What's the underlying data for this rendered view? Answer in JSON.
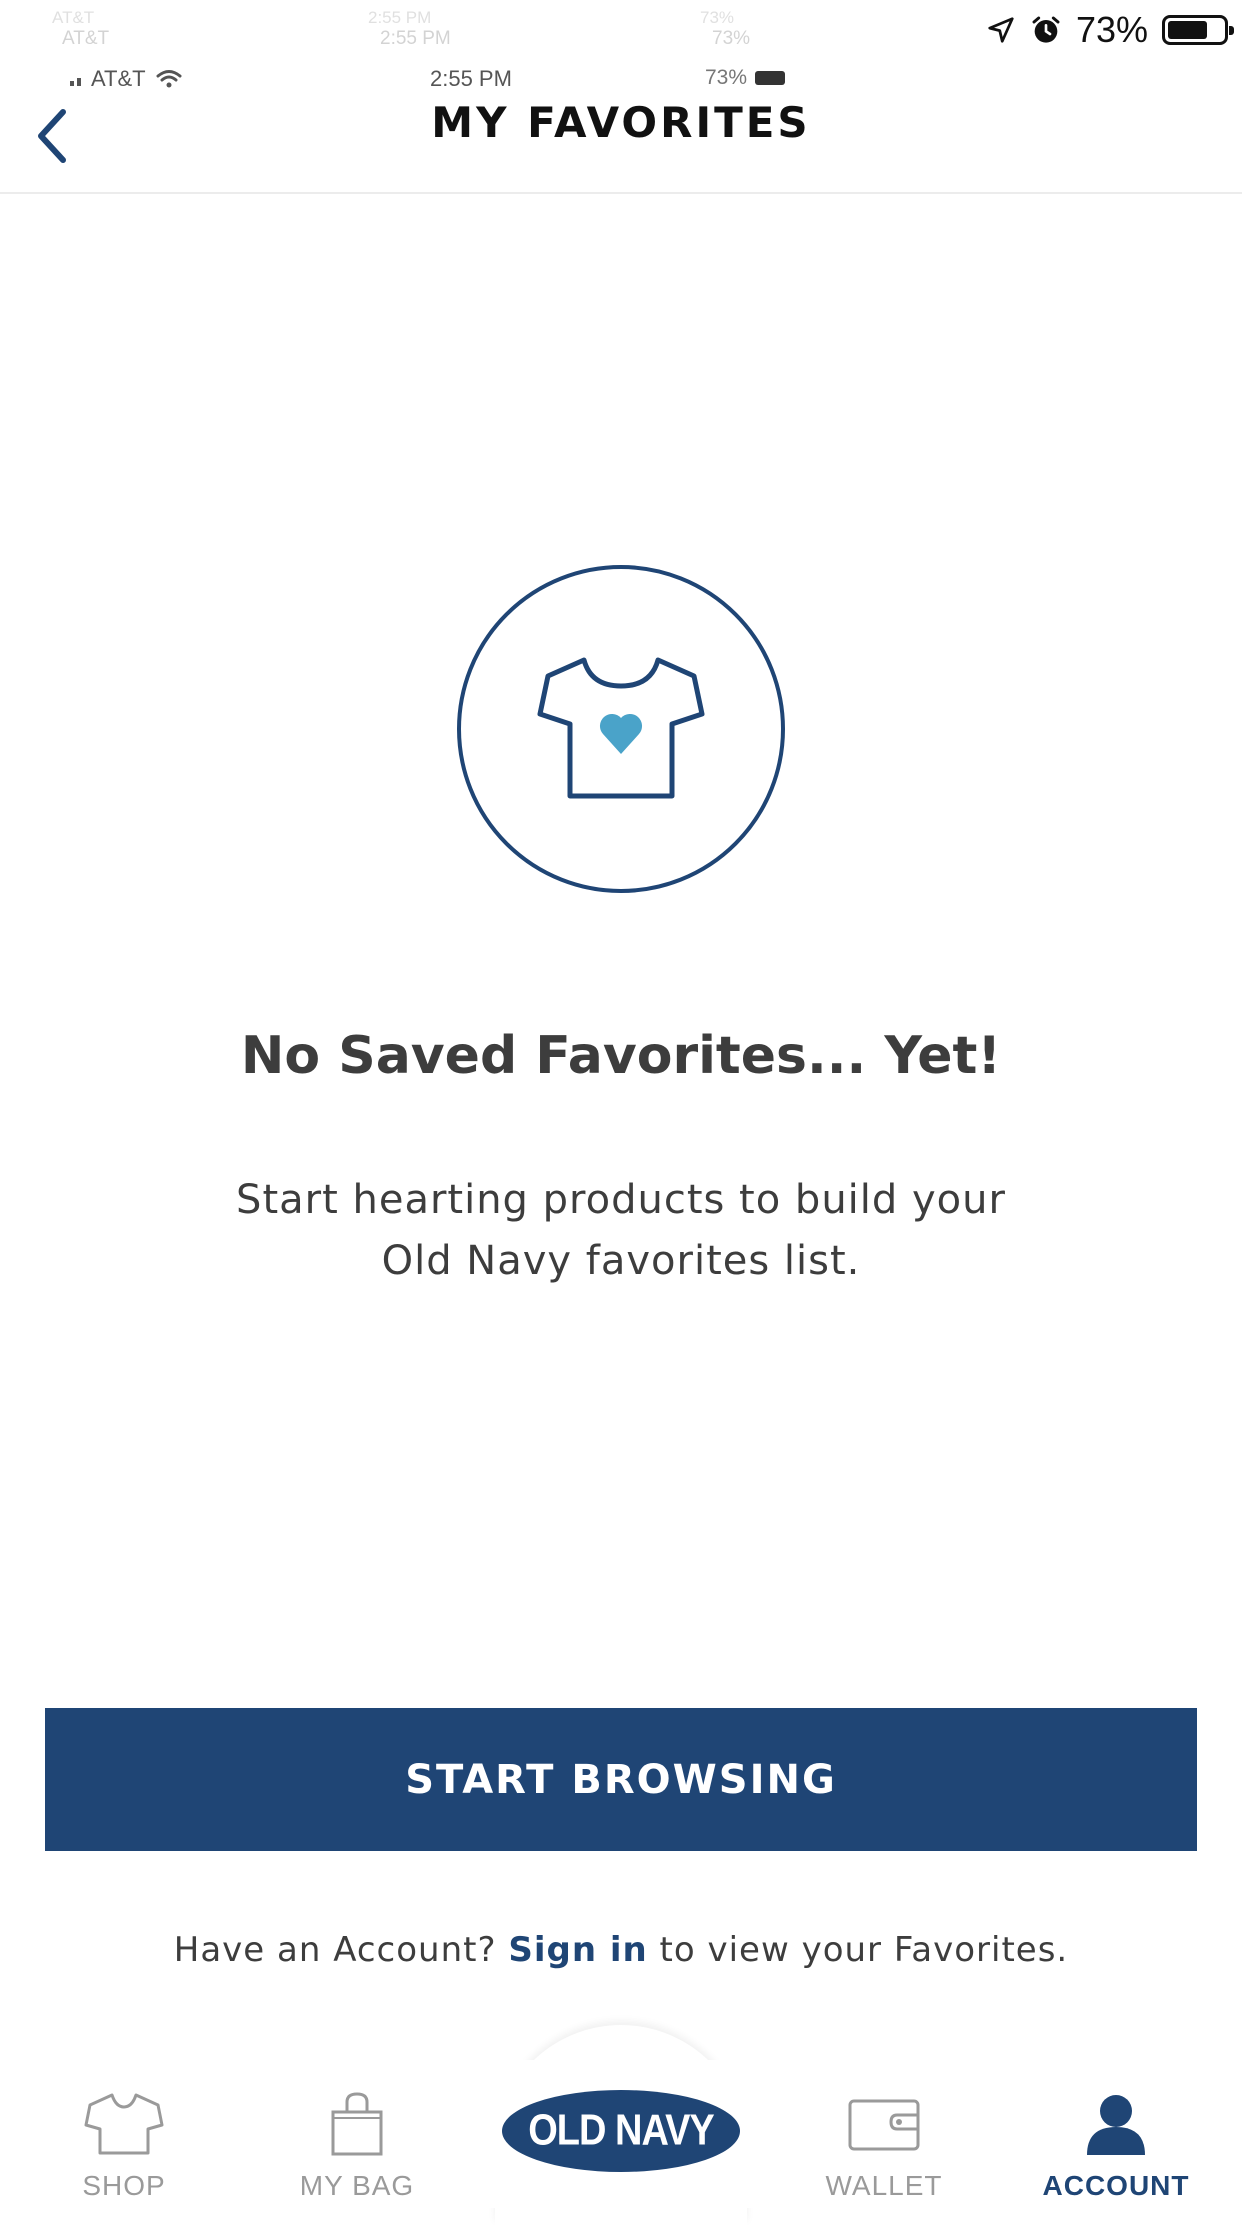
{
  "status_bar": {
    "carrier": "AT&T",
    "time": "2:55 PM",
    "battery_small": "73%",
    "battery_percent": "73%",
    "battery_level": 0.73
  },
  "header": {
    "title": "MY FAVORITES"
  },
  "empty_state": {
    "title": "No Saved Favorites... Yet!",
    "subtitle_line1": "Start hearting products to build your",
    "subtitle_line2": "Old Navy favorites list."
  },
  "cta": {
    "label": "START BROWSING"
  },
  "signin": {
    "prefix": "Have an Account?",
    "link": "Sign in",
    "suffix": "to view your Favorites."
  },
  "tabbar": {
    "shop": "SHOP",
    "bag": "MY BAG",
    "logo": "OLD NAVY",
    "wallet": "WALLET",
    "account": "ACCOUNT",
    "active": "account"
  },
  "colors": {
    "brand_navy": "#1f4575",
    "heart_blue": "#4aa3c9",
    "inactive_gray": "#9a9a9a",
    "text_dark": "#3d3d3d"
  },
  "icons": {
    "back": "chevron-left-icon",
    "empty": "tshirt-heart-icon",
    "shop": "tshirt-icon",
    "bag": "shopping-bag-icon",
    "wallet": "wallet-icon",
    "account": "person-icon"
  }
}
